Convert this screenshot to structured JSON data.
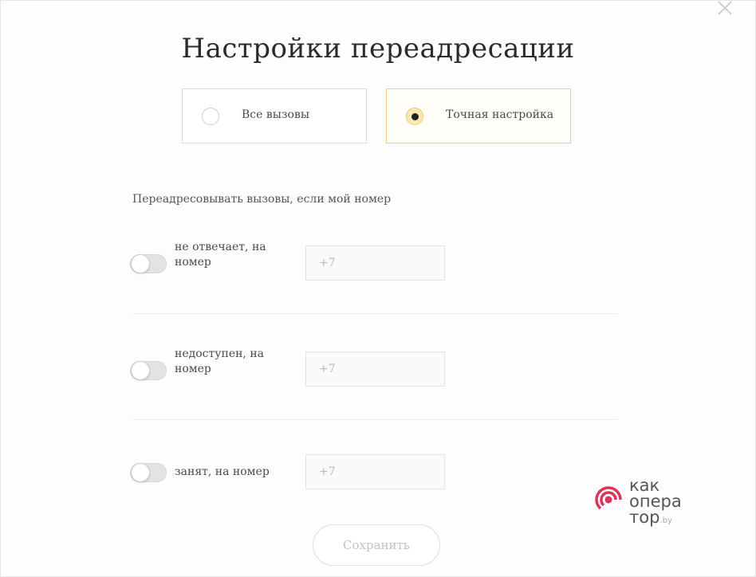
{
  "dialog": {
    "title": "Настройки переадресации",
    "close_icon": "close-icon"
  },
  "modes": [
    {
      "label": "Все вызовы",
      "selected": false
    },
    {
      "label": "Точная настройка",
      "selected": true
    }
  ],
  "section_label": "Переадресовывать вызовы, если мой номер",
  "rows": [
    {
      "label": "не отвечает, на номер",
      "enabled": false,
      "placeholder": "+7"
    },
    {
      "label": "недоступен, на номер",
      "enabled": false,
      "placeholder": "+7"
    },
    {
      "label": "занят, на номер",
      "enabled": false,
      "placeholder": "+7"
    }
  ],
  "save_label": "Сохранить",
  "watermark": {
    "line1": "как",
    "line2": "опера",
    "line3": "тор",
    "suffix": ".by"
  },
  "colors": {
    "accent_border": "#f0d487",
    "radio_active_fill": "#fbe9b0",
    "watermark_icon": "#e0315a"
  }
}
